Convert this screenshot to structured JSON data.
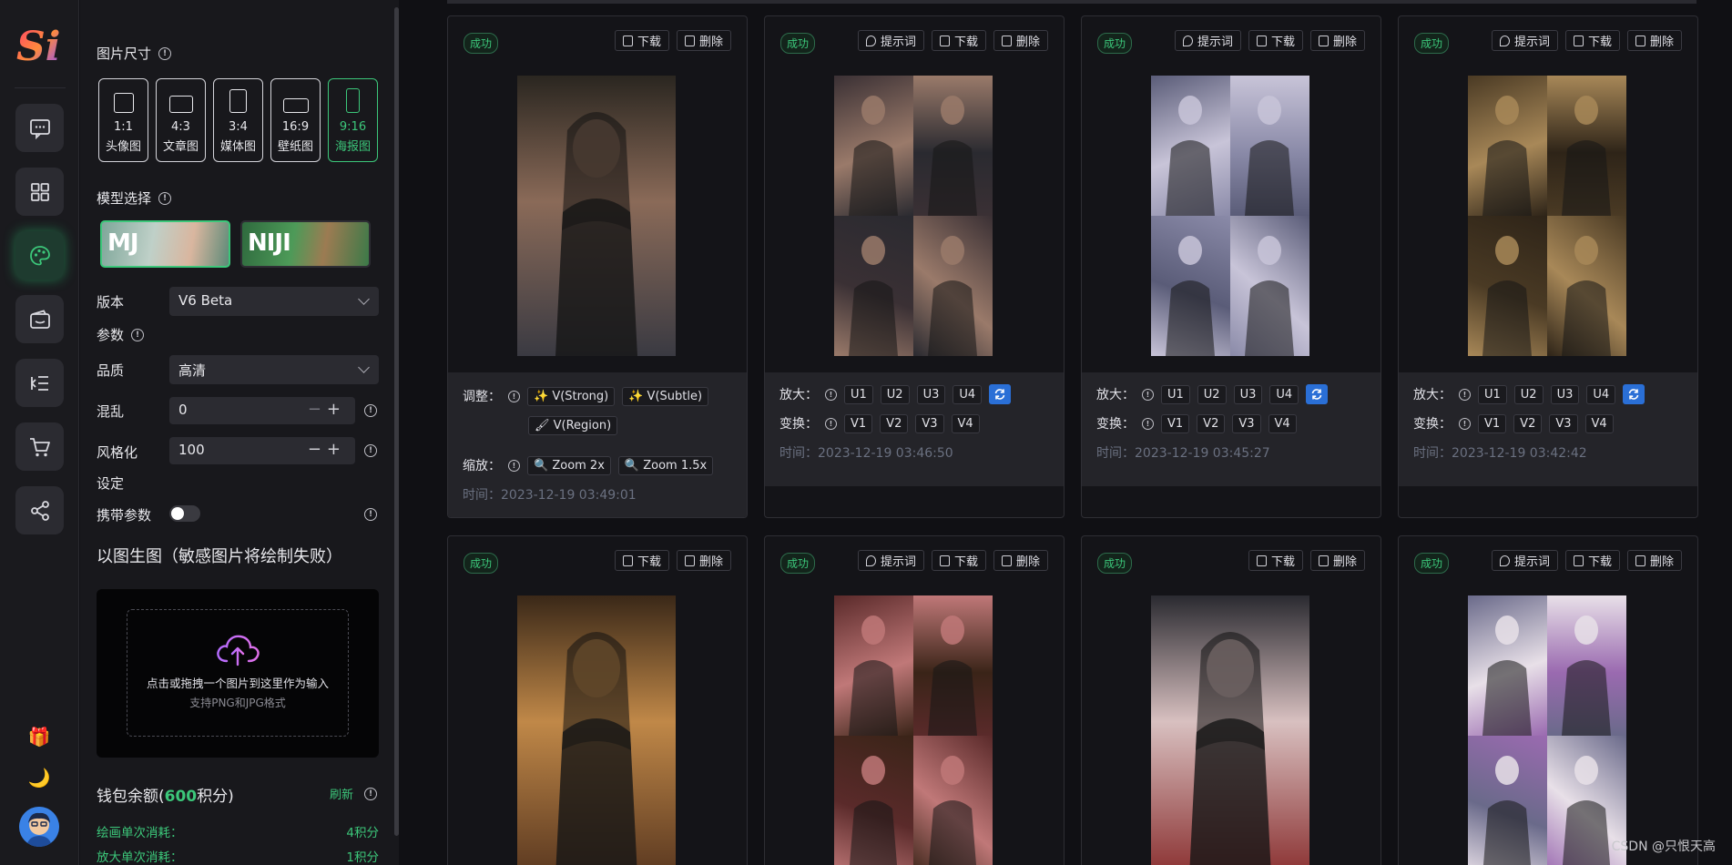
{
  "sidebar": {
    "logo_text": "Si",
    "nav": [
      {
        "name": "chat",
        "icon": "chat-icon"
      },
      {
        "name": "apps",
        "icon": "grid-icon"
      },
      {
        "name": "draw",
        "icon": "palette-icon",
        "active": true
      },
      {
        "name": "wallet",
        "icon": "wallet-icon"
      },
      {
        "name": "list",
        "icon": "list-icon"
      },
      {
        "name": "cart",
        "icon": "cart-icon"
      },
      {
        "name": "share",
        "icon": "share-icon"
      }
    ],
    "gift_glyph": "🎁",
    "moon_glyph": "🌙"
  },
  "settings": {
    "size_title": "图片尺寸",
    "ratios": [
      {
        "ratio": "1:1",
        "label": "头像图"
      },
      {
        "ratio": "4:3",
        "label": "文章图"
      },
      {
        "ratio": "3:4",
        "label": "媒体图"
      },
      {
        "ratio": "16:9",
        "label": "壁纸图"
      },
      {
        "ratio": "9:16",
        "label": "海报图",
        "active": true
      }
    ],
    "model_title": "模型选择",
    "models": [
      {
        "label": "MJ",
        "active": true
      },
      {
        "label": "NIJI",
        "active": false
      }
    ],
    "version_label": "版本",
    "version_value": "V6 Beta",
    "params_label": "参数",
    "quality_label": "品质",
    "quality_value": "高清",
    "chaos_label": "混乱",
    "chaos_value": "0",
    "stylize_label": "风格化",
    "stylize_value": "100",
    "setting_label": "设定",
    "carry_params_label": "携带参数",
    "img2img_title": "以图生图（敏感图片将绘制失败）",
    "upload_text": "点击或拖拽一个图片到这里作为输入",
    "upload_hint": "支持PNG和JPG格式",
    "wallet_prefix": "钱包余额(",
    "wallet_points": "600",
    "wallet_suffix": "积分)",
    "refresh_label": "刷新",
    "cost_draw_label": "绘画单次消耗：",
    "cost_draw_value": "4积分",
    "cost_upscale_label": "放大单次消耗：",
    "cost_upscale_value": "1积分"
  },
  "labels": {
    "success": "成功",
    "prompt": "提示词",
    "download": "下载",
    "delete": "删除",
    "adjust": "调整：",
    "zoom": "缩放：",
    "upscale": "放大：",
    "variation": "变换：",
    "time_prefix": "时间：",
    "v_strong": "V(Strong)",
    "v_subtle": "V(Subtle)",
    "v_region": "V(Region)",
    "zoom2x": "Zoom 2x",
    "zoom15x": "Zoom 1.5x",
    "u": [
      "U1",
      "U2",
      "U3",
      "U4"
    ],
    "v": [
      "V1",
      "V2",
      "V3",
      "V4"
    ]
  },
  "cards": [
    {
      "type": "single",
      "time": "2023-12-19 03:49:01",
      "has_prompt": false
    },
    {
      "type": "grid",
      "time": "2023-12-19 03:46:50",
      "has_prompt": true
    },
    {
      "type": "grid",
      "time": "2023-12-19 03:45:27",
      "has_prompt": true
    },
    {
      "type": "grid",
      "time": "2023-12-19 03:42:42",
      "has_prompt": true
    },
    {
      "type": "single",
      "has_prompt": false
    },
    {
      "type": "grid",
      "has_prompt": true
    },
    {
      "type": "single",
      "has_prompt": false
    },
    {
      "type": "grid",
      "has_prompt": true
    }
  ],
  "watermark": "CSDN @只恨天高",
  "colors": {
    "accent": "#3cc77a",
    "blue": "#2a6fd6",
    "bg": "#101014"
  }
}
